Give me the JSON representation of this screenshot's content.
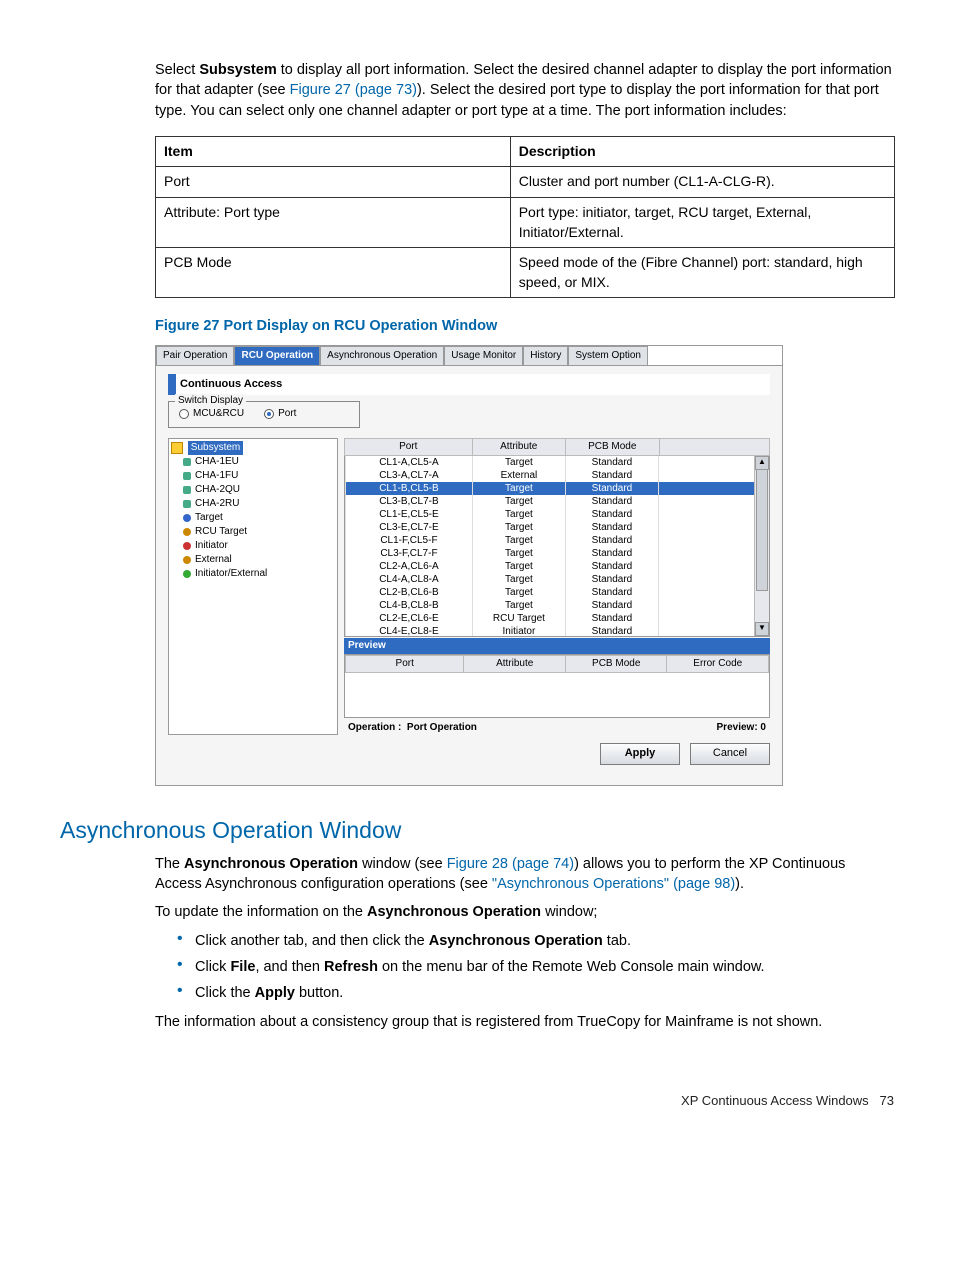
{
  "intro": {
    "select_lead": "Select ",
    "subsystem": "Subsystem",
    "text1": " to display all port information. Select the desired channel adapter to display the port information for that adapter (see ",
    "fig27_link": "Figure 27 (page 73)",
    "text2": "). Select the desired port type to display the port information for that port type. You can select only one channel adapter or port type at a time. The port information includes:"
  },
  "info_table": {
    "h1": "Item",
    "h2": "Description",
    "rows": [
      {
        "item": "Port",
        "desc": "Cluster and port number (CL1-A-CLG-R)."
      },
      {
        "item": "Attribute: Port type",
        "desc": "Port type: initiator, target, RCU target, External, Initiator/External."
      },
      {
        "item": "PCB Mode",
        "desc": "Speed mode of the (Fibre Channel) port: standard, high speed, or MIX."
      }
    ]
  },
  "figure_caption": "Figure 27 Port Display on RCU Operation Window",
  "app": {
    "tabs": [
      "Pair Operation",
      "RCU Operation",
      "Asynchronous Operation",
      "Usage Monitor",
      "History",
      "System Option"
    ],
    "title": "Continuous Access",
    "switch_legend": "Switch Display",
    "radio1": "MCU&RCU",
    "radio2": "Port",
    "tree": {
      "root": "Subsystem",
      "items": [
        {
          "label": "CHA-1EU",
          "cls": "ic-card"
        },
        {
          "label": "CHA-1FU",
          "cls": "ic-card"
        },
        {
          "label": "CHA-2QU",
          "cls": "ic-card"
        },
        {
          "label": "CHA-2RU",
          "cls": "ic-card"
        },
        {
          "label": "Target",
          "cls": "ic-target"
        },
        {
          "label": "RCU Target",
          "cls": "ic-rcutgt"
        },
        {
          "label": "Initiator",
          "cls": "ic-init"
        },
        {
          "label": "External",
          "cls": "ic-ext"
        },
        {
          "label": "Initiator/External",
          "cls": "ic-iext"
        }
      ]
    },
    "port_headers": [
      "Port",
      "Attribute",
      "PCB Mode",
      ""
    ],
    "port_rows": [
      {
        "p": "CL1-A,CL5-A",
        "a": "Target",
        "m": "Standard",
        "sel": false
      },
      {
        "p": "CL3-A,CL7-A",
        "a": "External",
        "m": "Standard",
        "sel": false
      },
      {
        "p": "CL1-B,CL5-B",
        "a": "Target",
        "m": "Standard",
        "sel": true
      },
      {
        "p": "CL3-B,CL7-B",
        "a": "Target",
        "m": "Standard",
        "sel": false
      },
      {
        "p": "CL1-E,CL5-E",
        "a": "Target",
        "m": "Standard",
        "sel": false
      },
      {
        "p": "CL3-E,CL7-E",
        "a": "Target",
        "m": "Standard",
        "sel": false
      },
      {
        "p": "CL1-F,CL5-F",
        "a": "Target",
        "m": "Standard",
        "sel": false
      },
      {
        "p": "CL3-F,CL7-F",
        "a": "Target",
        "m": "Standard",
        "sel": false
      },
      {
        "p": "CL2-A,CL6-A",
        "a": "Target",
        "m": "Standard",
        "sel": false
      },
      {
        "p": "CL4-A,CL8-A",
        "a": "Target",
        "m": "Standard",
        "sel": false
      },
      {
        "p": "CL2-B,CL6-B",
        "a": "Target",
        "m": "Standard",
        "sel": false
      },
      {
        "p": "CL4-B,CL8-B",
        "a": "Target",
        "m": "Standard",
        "sel": false
      },
      {
        "p": "CL2-E,CL6-E",
        "a": "RCU Target",
        "m": "Standard",
        "sel": false
      },
      {
        "p": "CL4-E,CL8-E",
        "a": "Initiator",
        "m": "Standard",
        "sel": false
      }
    ],
    "preview_label": "Preview",
    "preview_headers": [
      "Port",
      "Attribute",
      "PCB Mode",
      "Error Code"
    ],
    "op_label": "Operation :",
    "op_value": "Port Operation",
    "preview_count": "Preview: 0",
    "apply": "Apply",
    "cancel": "Cancel"
  },
  "section_heading": "Asynchronous Operation Window",
  "para1": {
    "t1": "The ",
    "b1": "Asynchronous Operation",
    "t2": " window (see ",
    "link1": "Figure 28 (page 74)",
    "t3": ") allows you to perform the XP Continuous Access Asynchronous configuration operations (see ",
    "link2": "\"Asynchronous Operations\" (page 98)",
    "t4": ")."
  },
  "para2": {
    "t1": "To update the information on the ",
    "b1": "Asynchronous Operation",
    "t2": " window;"
  },
  "bullets": [
    {
      "pre": "Click another tab, and then click the ",
      "b": "Asynchronous Operation",
      "post": " tab."
    },
    {
      "pre": "Click ",
      "b": "File",
      "mid": ", and then ",
      "b2": "Refresh",
      "post": " on the menu bar of the Remote Web Console main window."
    },
    {
      "pre": "Click the ",
      "b": "Apply",
      "post": " button."
    }
  ],
  "para3": "The information about a consistency group that is registered from TrueCopy for Mainframe is not shown.",
  "footer": {
    "label": "XP Continuous Access Windows",
    "page": "73"
  }
}
